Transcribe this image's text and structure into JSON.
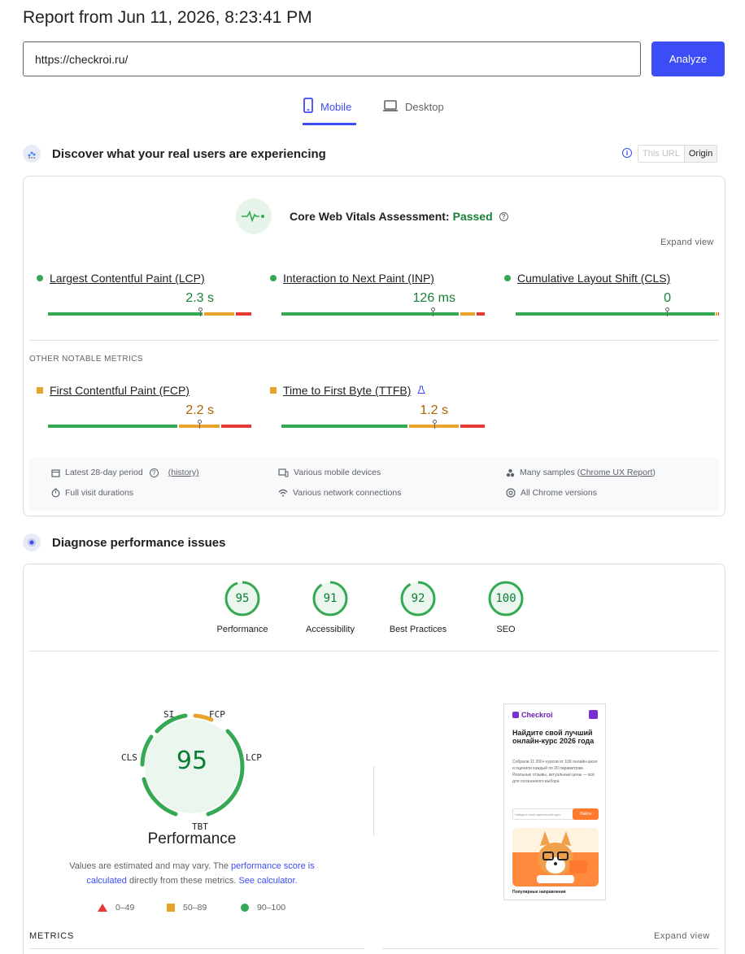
{
  "header": {
    "title": "Report from Jun 11, 2026, 8:23:41 PM",
    "url_value": "https://checkroi.ru/",
    "analyze_label": "Analyze"
  },
  "tabs": [
    {
      "label": "Mobile",
      "active": true,
      "icon": "smartphone-icon"
    },
    {
      "label": "Desktop",
      "active": false,
      "icon": "laptop-icon"
    }
  ],
  "field_data": {
    "heading": "Discover what your real users are experiencing",
    "toggle": {
      "this_url": "This URL",
      "origin": "Origin",
      "selected": "Origin"
    },
    "assessment_label": "Core Web Vitals Assessment:",
    "assessment_status": "Passed",
    "expand_label": "Expand view",
    "core_metrics": [
      {
        "name": "Largest Contentful Paint (LCP)",
        "value": "2.3 s",
        "status": "good",
        "marker_fraction": 0.75
      },
      {
        "name": "Interaction to Next Paint (INP)",
        "value": "126 ms",
        "status": "good",
        "marker_fraction": 0.75
      },
      {
        "name": "Cumulative Layout Shift (CLS)",
        "value": "0",
        "status": "good",
        "marker_fraction": 0.75
      }
    ],
    "other_label": "OTHER NOTABLE METRICS",
    "other_metrics": [
      {
        "name": "First Contentful Paint (FCP)",
        "value": "2.2 s",
        "status": "needs-improvement"
      },
      {
        "name": "Time to First Byte (TTFB)",
        "value": "1.2 s",
        "status": "needs-improvement",
        "experimental": true
      }
    ],
    "info": {
      "period": "Latest 28-day period",
      "history": "(history)",
      "durations": "Full visit durations",
      "devices": "Various mobile devices",
      "network": "Various network connections",
      "samples_prefix": "Many samples (",
      "samples_link": "Chrome UX Report",
      "samples_suffix": ")",
      "versions": "All Chrome versions"
    }
  },
  "lab_data": {
    "heading": "Diagnose performance issues",
    "scores": [
      {
        "label": "Performance",
        "score": "95",
        "value": 95
      },
      {
        "label": "Accessibility",
        "score": "91",
        "value": 91
      },
      {
        "label": "Best Practices",
        "score": "92",
        "value": 92
      },
      {
        "label": "SEO",
        "score": "100",
        "value": 100
      }
    ],
    "big_gauge": {
      "score": "95",
      "title": "Performance",
      "labels": {
        "si": "SI",
        "fcp": "FCP",
        "lcp": "LCP",
        "tbt": "TBT",
        "cls": "CLS"
      }
    },
    "note": {
      "p1": "Values are estimated and may vary. The ",
      "link1": "performance score is calculated",
      "p2": " directly from these metrics. ",
      "link2": "See calculator."
    },
    "legend": [
      {
        "range": "0–49",
        "shape": "triangle",
        "color": "#e53935"
      },
      {
        "range": "50–89",
        "shape": "square",
        "color": "#e8a32b"
      },
      {
        "range": "90–100",
        "shape": "circle",
        "color": "#34a853"
      }
    ],
    "metrics_label": "METRICS",
    "expand_label": "Expand view"
  },
  "screenshot": {
    "brand": "Checkroi",
    "headline": "Найдите свой лучший онлайн-курс 2026 года",
    "paragraph": "Собрали 11 200+ курсов от 109 онлайн-школ и оценили каждый по 20 параметрам. Реальные отзывы, актуальные цены — всё для осознанного выбора",
    "search_placeholder": "Найдите свой идеальный курс",
    "search_button": "Найти",
    "footer": "Популярные направления"
  },
  "colors": {
    "accent": "#3c4cf6",
    "good": "#188038",
    "average": "#e8a32b",
    "poor": "#e53935"
  }
}
